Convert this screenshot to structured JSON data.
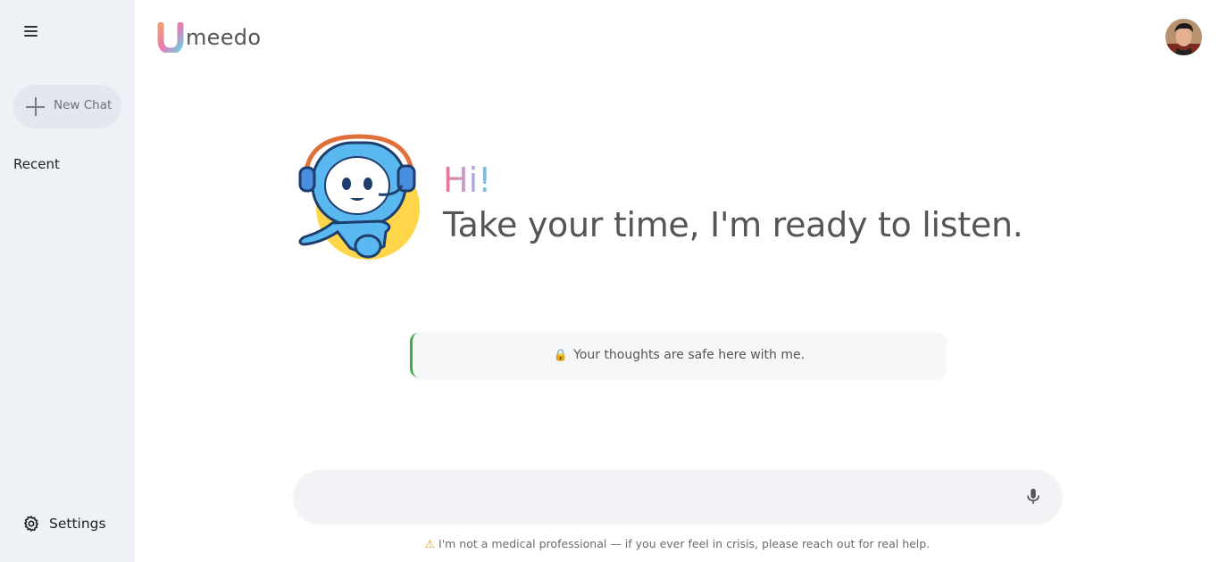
{
  "sidebar": {
    "new_chat_label": "New Chat",
    "recent_label": "Recent",
    "settings_label": "Settings"
  },
  "header": {
    "logo_text": "meedo",
    "logo_letter": "U"
  },
  "hero": {
    "greeting": "Hi!",
    "tagline": "Take your time, I'm ready to listen."
  },
  "notice": {
    "icon": "lock-icon",
    "text": "Your thoughts are safe here with me."
  },
  "composer": {
    "placeholder": "",
    "value": ""
  },
  "footer": {
    "icon": "warning-icon",
    "disclaimer": "I'm not a medical professional — if you ever feel in crisis, please reach out for real help."
  },
  "colors": {
    "sidebar_bg": "#eef1f6",
    "accent_green": "#3fae45",
    "greeting_gradient": [
      "#ec6f8a",
      "#c7a0d6",
      "#5ec8e6"
    ]
  }
}
